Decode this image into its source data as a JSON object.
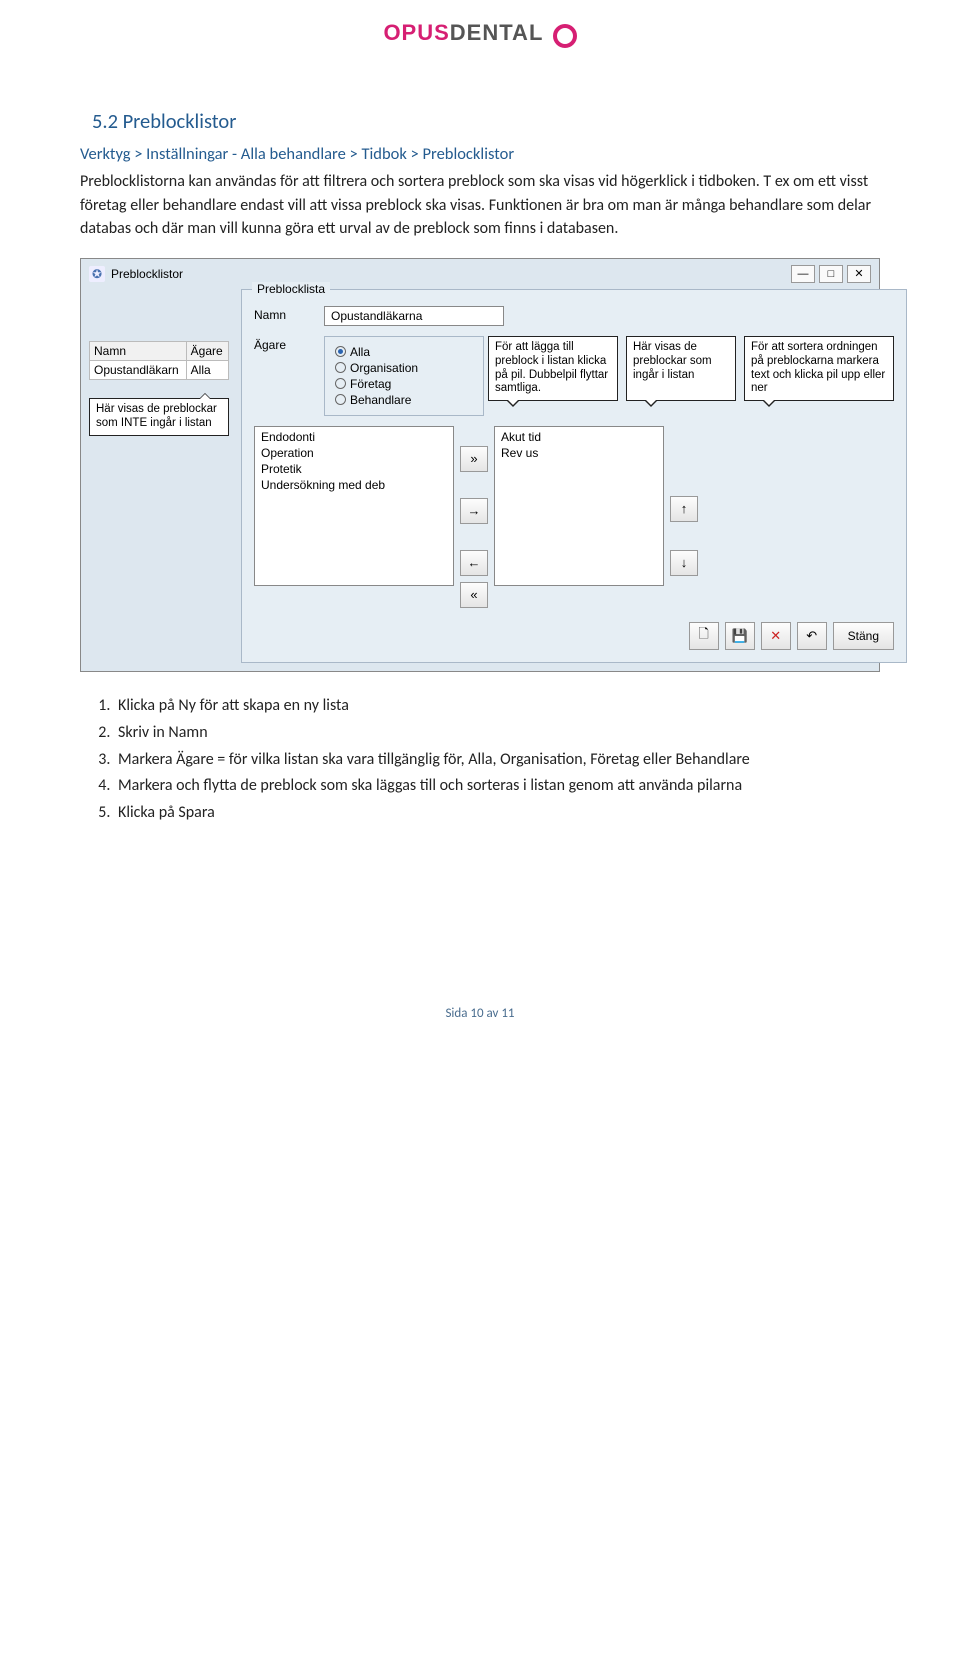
{
  "logo": {
    "part1": "OPUS",
    "part2": "DENTAL"
  },
  "section_title": "5.2 Preblocklistor",
  "breadcrumb": "Verktyg > Inställningar - Alla behandlare > Tidbok > Preblocklistor",
  "para1": "Preblocklistorna kan användas för att filtrera och sortera preblock som ska visas vid högerklick i tidboken. T ex om ett visst företag eller behandlare endast vill att vissa preblock ska visas. Funktionen är bra om man är många behandlare som delar databas och där man vill kunna göra ett urval av de preblock som finns i databasen.",
  "window": {
    "title": "Preblocklistor",
    "group_title": "Preblocklista",
    "name_label": "Namn",
    "name_value": "Opustandläkarna",
    "owner_label": "Ägare",
    "owner_options": [
      "Alla",
      "Organisation",
      "Företag",
      "Behandlare"
    ],
    "owner_selected": 0,
    "left_table": {
      "headers": [
        "Namn",
        "Ägare"
      ],
      "row": [
        "Opustandläkarn",
        "Alla"
      ]
    },
    "callout_left": "Här visas de preblockar som INTE ingår i listan",
    "callout_add": "För att lägga till preblock i listan klicka på pil. Dubbelpil flyttar samtliga.",
    "callout_included": "Här visas de preblockar som ingår i listan",
    "callout_sort": "För att sortera ordningen på preblockarna markera text och klicka pil upp eller ner",
    "left_list": [
      "Endodonti",
      "Operation",
      "Protetik",
      "Undersökning med deb"
    ],
    "right_list": [
      "Akut tid",
      "Rev us"
    ],
    "close_btn": "Stäng"
  },
  "instructions": [
    "Klicka på Ny för att skapa en ny lista",
    "Skriv in Namn",
    "Markera Ägare = för vilka listan ska vara tillgänglig för, Alla, Organisation, Företag eller Behandlare",
    "Markera och flytta de preblock som ska läggas till och sorteras i listan genom att använda pilarna",
    "Klicka på Spara"
  ],
  "footer": "Sida 10 av 11"
}
